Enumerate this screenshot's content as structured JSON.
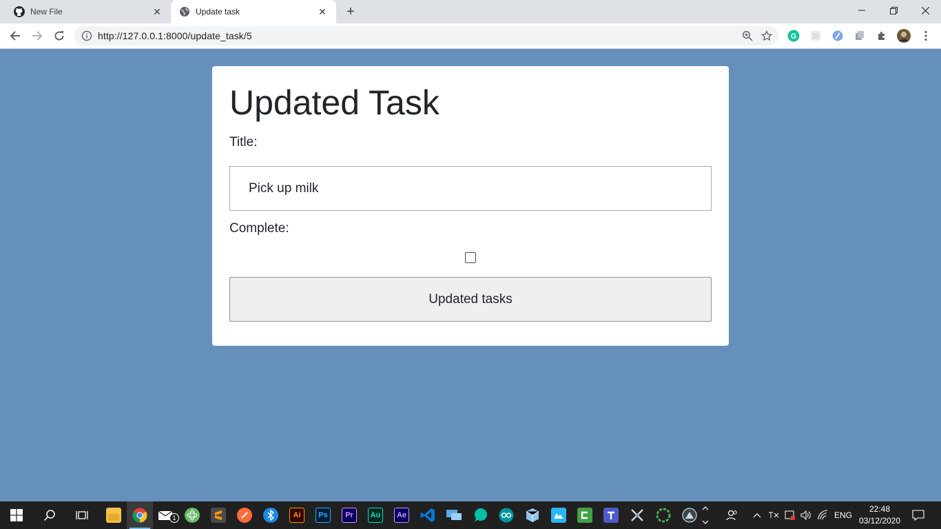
{
  "browser": {
    "tabs": [
      {
        "title": "New File",
        "icon": "github-icon",
        "active": false
      },
      {
        "title": "Update task",
        "icon": "globe-icon",
        "active": true
      }
    ],
    "close_glyph": "✕",
    "new_tab_glyph": "+",
    "url": "http://127.0.0.1:8000/update_task/5",
    "window_controls": {
      "minimize": "—",
      "maximize": "❐",
      "close": "✕"
    }
  },
  "page": {
    "heading": "Updated Task",
    "title_label": "Title:",
    "title_value": "Pick up milk",
    "complete_label": "Complete:",
    "complete_checked": false,
    "submit_label": "Updated tasks"
  },
  "colors": {
    "page_background": "#6590bb",
    "card_background": "#ffffff",
    "button_background": "#efefef"
  },
  "taskbar": {
    "apps": [
      {
        "name": "file-explorer-icon",
        "label": ""
      },
      {
        "name": "chrome-icon",
        "label": ""
      },
      {
        "name": "mail-icon",
        "label": ""
      },
      {
        "name": "atom-icon",
        "label": ""
      },
      {
        "name": "sublime-text-icon",
        "label": ""
      },
      {
        "name": "postman-icon",
        "label": ""
      },
      {
        "name": "bluetooth-icon",
        "label": ""
      },
      {
        "name": "illustrator-icon",
        "label": "Ai"
      },
      {
        "name": "photoshop-icon",
        "label": "Ps"
      },
      {
        "name": "premiere-icon",
        "label": "Pr"
      },
      {
        "name": "audition-icon",
        "label": "Au"
      },
      {
        "name": "after-effects-icon",
        "label": "Ae"
      },
      {
        "name": "vscode-icon",
        "label": ""
      },
      {
        "name": "remote-desktop-icon",
        "label": ""
      },
      {
        "name": "chat-icon",
        "label": ""
      },
      {
        "name": "arduino-icon",
        "label": ""
      },
      {
        "name": "virtualbox-icon",
        "label": ""
      },
      {
        "name": "app-icon",
        "label": ""
      },
      {
        "name": "camtasia-icon",
        "label": ""
      },
      {
        "name": "teams-icon",
        "label": ""
      },
      {
        "name": "network-tool-icon",
        "label": ""
      },
      {
        "name": "circle-app-icon",
        "label": ""
      },
      {
        "name": "inkscape-icon",
        "label": ""
      }
    ],
    "mail_badge": "1",
    "language": "ENG",
    "time": "22:48",
    "date": "03/12/2020"
  }
}
